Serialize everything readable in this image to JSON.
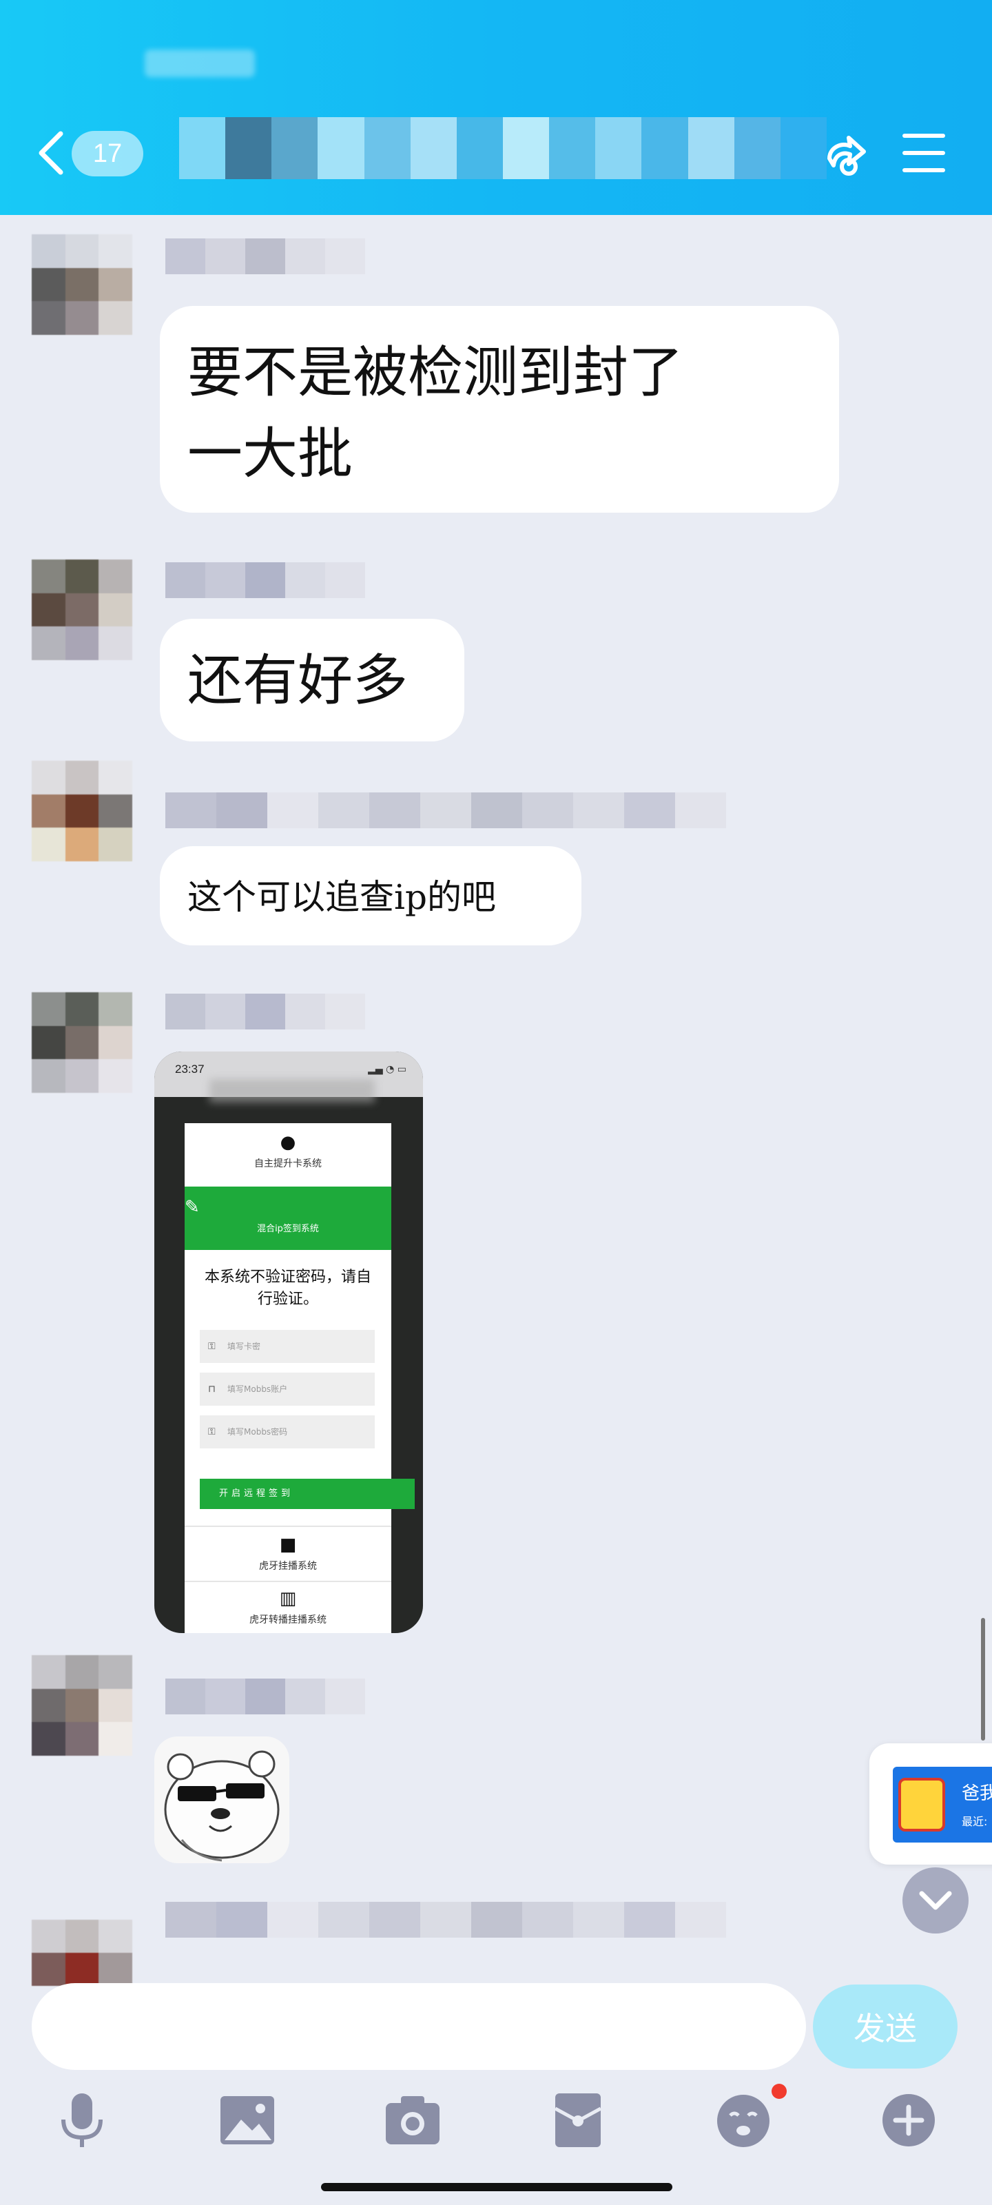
{
  "header": {
    "unread_count": "17",
    "title": "",
    "colors": {
      "gradient_start": "#18c9f6",
      "gradient_end": "#12aef2"
    }
  },
  "messages": [
    {
      "type": "text",
      "text": "要不是被检测到封了\n一大批"
    },
    {
      "type": "text",
      "text": "还有好多"
    },
    {
      "type": "text",
      "text": "这个可以追查ip的吧"
    },
    {
      "type": "image",
      "phone": {
        "time": "23:37",
        "items": [
          {
            "label": "自主提升卡系统",
            "icon": "user-icon"
          },
          {
            "label": "混合ip签到系统",
            "icon": "edit-icon"
          }
        ],
        "heading": "本系统不验证密码，请自行验证。",
        "fields": [
          {
            "placeholder": "填写卡密",
            "icon": "key-icon"
          },
          {
            "placeholder": "填写Mobbs账户",
            "icon": "lock-icon"
          },
          {
            "placeholder": "填写Mobbs密码",
            "icon": "key-icon"
          }
        ],
        "button": "开启远程签到",
        "bottom_items": [
          {
            "label": "虎牙挂播系统",
            "icon": "lock-icon"
          },
          {
            "label": "虎牙转播挂播系统",
            "icon": "map-icon"
          }
        ]
      }
    },
    {
      "type": "sticker",
      "icon": "bear-sticker-icon"
    }
  ],
  "floating_card": {
    "title": "爸我",
    "subtitle": "最近:"
  },
  "composer": {
    "input_value": "",
    "send_label": "发送"
  },
  "toolbar": {
    "icons": [
      "microphone-icon",
      "image-icon",
      "camera-icon",
      "red-packet-icon",
      "emoji-icon",
      "plus-icon"
    ]
  }
}
